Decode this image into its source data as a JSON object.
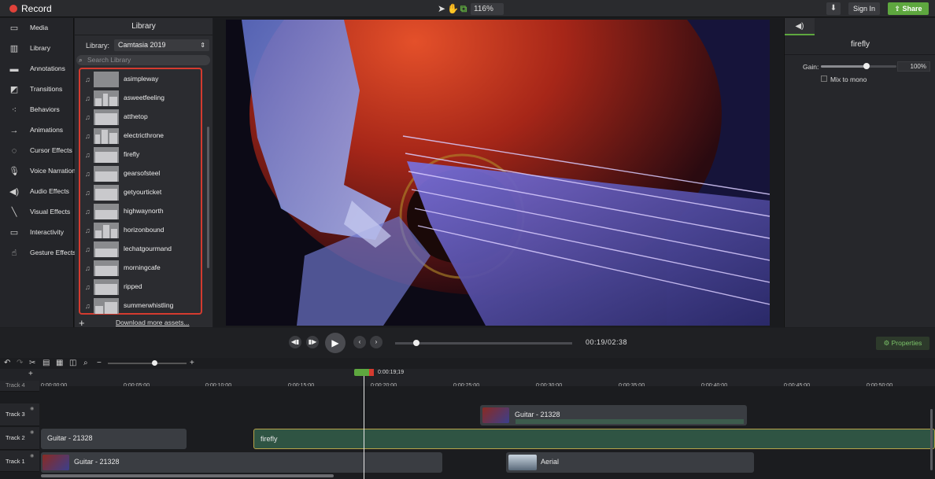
{
  "topbar": {
    "record_label": "Record",
    "zoom": "116%",
    "sign_in": "Sign In",
    "share": "Share"
  },
  "nav": [
    {
      "label": "Media",
      "icon": "film-icon"
    },
    {
      "label": "Library",
      "icon": "library-icon"
    },
    {
      "label": "Annotations",
      "icon": "annotation-icon"
    },
    {
      "label": "Transitions",
      "icon": "transition-icon"
    },
    {
      "label": "Behaviors",
      "icon": "behavior-icon"
    },
    {
      "label": "Animations",
      "icon": "animation-icon"
    },
    {
      "label": "Cursor Effects",
      "icon": "cursor-icon"
    },
    {
      "label": "Voice Narration",
      "icon": "microphone-icon"
    },
    {
      "label": "Audio Effects",
      "icon": "speaker-icon"
    },
    {
      "label": "Visual Effects",
      "icon": "wand-icon"
    },
    {
      "label": "Interactivity",
      "icon": "interactivity-icon"
    },
    {
      "label": "Gesture Effects",
      "icon": "gesture-icon"
    }
  ],
  "library": {
    "header": "Library",
    "library_label": "Library:",
    "selected_library": "Camtasia 2019",
    "search_placeholder": "Search Library",
    "items": [
      "asimpleway",
      "asweetfeeling",
      "atthetop",
      "electricthrone",
      "firefly",
      "gearsofsteel",
      "getyourticket",
      "highwaynorth",
      "horizonbound",
      "lechatgourmand",
      "morningcafe",
      "ripped",
      "summerwhistling"
    ],
    "download_link": "Download more assets..."
  },
  "properties": {
    "title": "firefly",
    "gain_label": "Gain:",
    "gain_value": "100%",
    "gain_level": 0.6,
    "mix_to_mono": "Mix to mono",
    "properties_button": "Properties"
  },
  "playback": {
    "time": "00:19/02:38",
    "progress": 0.12
  },
  "timeline": {
    "playhead_time": "0:00:19;19",
    "ruler_ticks": [
      "0:00:00;00",
      "0:00:05;00",
      "0:00:10;00",
      "0:00:15;00",
      "0:00:20;00",
      "0:00:25;00",
      "0:00:30;00",
      "0:00:35;00",
      "0:00:40;00",
      "0:00:45;00",
      "0:00:50;00"
    ],
    "tracks": [
      {
        "label": "Track 4"
      },
      {
        "label": "Track 3",
        "clips": [
          {
            "label": "Guitar - 21328"
          }
        ]
      },
      {
        "label": "Track 2",
        "clips": [
          {
            "label": "Guitar - 21328"
          },
          {
            "label": "firefly"
          }
        ]
      },
      {
        "label": "Track 1",
        "clips": [
          {
            "label": "Guitar - 21328"
          },
          {
            "label": "Aerial"
          }
        ]
      }
    ]
  },
  "colors": {
    "accent_green": "#5ea73f",
    "record_red": "#e0423a",
    "selection_red": "#d43b2f"
  }
}
